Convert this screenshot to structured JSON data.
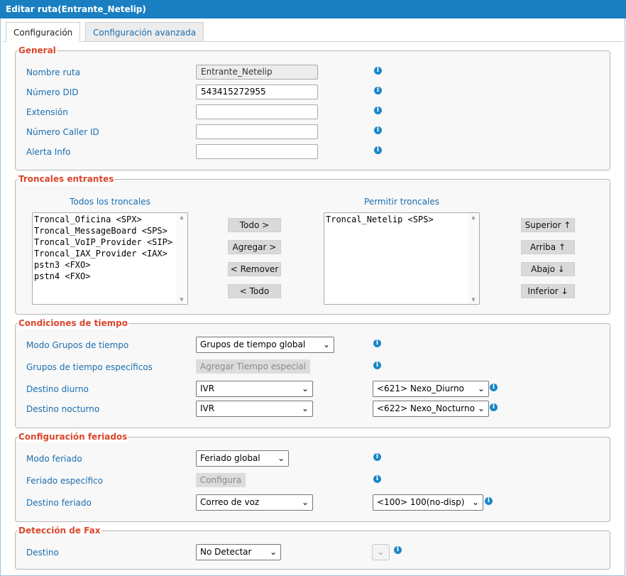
{
  "window": {
    "title": "Editar ruta(Entrante_Netelip)"
  },
  "tabs": [
    {
      "label": "Configuración",
      "active": true
    },
    {
      "label": "Configuración avanzada",
      "active": false
    }
  ],
  "general": {
    "legend": "General",
    "route_name_label": "Nombre ruta",
    "route_name_value": "Entrante_Netelip",
    "did_label": "Número DID",
    "did_value": "543415272955",
    "extension_label": "Extensión",
    "extension_value": "",
    "callerid_label": "Número Caller ID",
    "callerid_value": "",
    "alertinfo_label": "Alerta Info",
    "alertinfo_value": ""
  },
  "trunks": {
    "legend": "Troncales entrantes",
    "all_header": "Todos los troncales",
    "allowed_header": "Permitir troncales",
    "all_items": [
      "Troncal_Oficina <SPX>",
      "Troncal_MessageBoard <SPS>",
      "Troncal_VoIP_Provider <SIP>",
      "Troncal_IAX_Provider <IAX>",
      "pstn3 <FXO>",
      "pstn4 <FXO>"
    ],
    "allowed_items": [
      "Troncal_Netelip <SPS>"
    ],
    "btn_all": "Todo >",
    "btn_add": "Agregar >",
    "btn_remove": "< Remover",
    "btn_remove_all": "< Todo",
    "btn_top": "Superior ↑",
    "btn_up": "Arriba ↑",
    "btn_down": "Abajo ↓",
    "btn_bottom": "Inferior ↓"
  },
  "time": {
    "legend": "Condiciones de tiempo",
    "mode_label": "Modo Grupos de tiempo",
    "mode_value": "Grupos de tiempo global",
    "specific_label": "Grupos de tiempo específicos",
    "specific_button": "Agregar Tiempo especial",
    "day_label": "Destino diurno",
    "day_type": "IVR",
    "day_target": "<621> Nexo_Diurno",
    "night_label": "Destino nocturno",
    "night_type": "IVR",
    "night_target": "<622> Nexo_Nocturno"
  },
  "holiday": {
    "legend": "Configuración feriados",
    "mode_label": "Modo feriado",
    "mode_value": "Feriado global",
    "specific_label": "Feriado específico",
    "specific_button": "Configura",
    "dest_label": "Destino feriado",
    "dest_type": "Correo de voz",
    "dest_target": "<100> 100(no-disp)"
  },
  "fax": {
    "legend": "Detección de Fax",
    "dest_label": "Destino",
    "dest_value": "No Detectar"
  },
  "icons": {
    "info": "info-icon",
    "chevron": "chevron-down-icon"
  },
  "colors": {
    "titlebar": "#1a7fc1",
    "legend": "#d9472b",
    "label": "#1a6eb0",
    "info": "#1a86c8"
  }
}
